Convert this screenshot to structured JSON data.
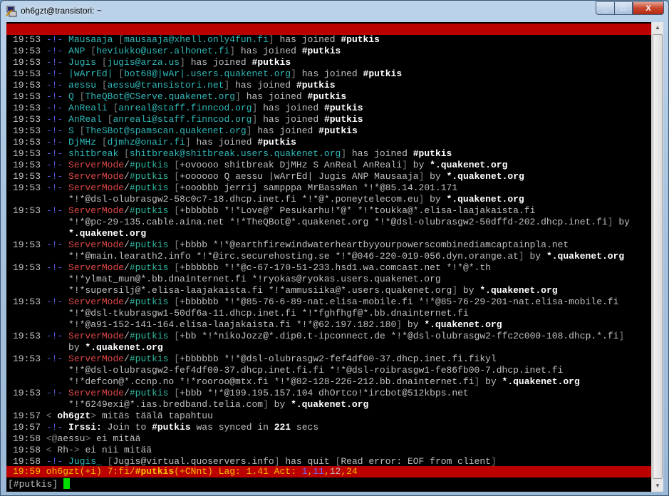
{
  "window": {
    "title": "oh6gzt@transistori: ~",
    "minimize": "_",
    "maximize": "□",
    "close": "X"
  },
  "colors": {
    "topbar": "#bb0000",
    "status_bg": "#bb0000",
    "cursor": "#00e000"
  },
  "lines": [
    [
      [
        "19:53 ",
        "d"
      ],
      [
        "-!- ",
        "b"
      ],
      [
        "Mausaaja ",
        "c"
      ],
      [
        "[",
        "k"
      ],
      [
        "mausaaja@xhell.only4fun.fi",
        "c"
      ],
      [
        "] ",
        "k"
      ],
      [
        "has joined ",
        "d"
      ],
      [
        "#putkis",
        "w"
      ]
    ],
    [
      [
        "19:53 ",
        "d"
      ],
      [
        "-!- ",
        "b"
      ],
      [
        "ANP ",
        "c"
      ],
      [
        "[",
        "k"
      ],
      [
        "heviukko@user.alhonet.fi",
        "c"
      ],
      [
        "] ",
        "k"
      ],
      [
        "has joined ",
        "d"
      ],
      [
        "#putkis",
        "w"
      ]
    ],
    [
      [
        "19:53 ",
        "d"
      ],
      [
        "-!- ",
        "b"
      ],
      [
        "Jugis ",
        "c"
      ],
      [
        "[",
        "k"
      ],
      [
        "jugis@arza.us",
        "c"
      ],
      [
        "] ",
        "k"
      ],
      [
        "has joined ",
        "d"
      ],
      [
        "#putkis",
        "w"
      ]
    ],
    [
      [
        "19:53 ",
        "d"
      ],
      [
        "-!- ",
        "b"
      ],
      [
        "|wArrEd| ",
        "c"
      ],
      [
        "[",
        "k"
      ],
      [
        "bot68@|wAr|.users.quakenet.org",
        "c"
      ],
      [
        "] ",
        "k"
      ],
      [
        "has joined ",
        "d"
      ],
      [
        "#putkis",
        "w"
      ]
    ],
    [
      [
        "19:53 ",
        "d"
      ],
      [
        "-!- ",
        "b"
      ],
      [
        "aessu ",
        "c"
      ],
      [
        "[",
        "k"
      ],
      [
        "aessu@transistori.net",
        "c"
      ],
      [
        "] ",
        "k"
      ],
      [
        "has joined ",
        "d"
      ],
      [
        "#putkis",
        "w"
      ]
    ],
    [
      [
        "19:53 ",
        "d"
      ],
      [
        "-!- ",
        "b"
      ],
      [
        "Q ",
        "c"
      ],
      [
        "[",
        "k"
      ],
      [
        "TheQBot@CServe.quakenet.org",
        "c"
      ],
      [
        "] ",
        "k"
      ],
      [
        "has joined ",
        "d"
      ],
      [
        "#putkis",
        "w"
      ]
    ],
    [
      [
        "19:53 ",
        "d"
      ],
      [
        "-!- ",
        "b"
      ],
      [
        "AnReali ",
        "c"
      ],
      [
        "[",
        "k"
      ],
      [
        "anreal@staff.finncod.org",
        "c"
      ],
      [
        "] ",
        "k"
      ],
      [
        "has joined ",
        "d"
      ],
      [
        "#putkis",
        "w"
      ]
    ],
    [
      [
        "19:53 ",
        "d"
      ],
      [
        "-!- ",
        "b"
      ],
      [
        "AnReal ",
        "c"
      ],
      [
        "[",
        "k"
      ],
      [
        "anreali@staff.finncod.org",
        "c"
      ],
      [
        "] ",
        "k"
      ],
      [
        "has joined ",
        "d"
      ],
      [
        "#putkis",
        "w"
      ]
    ],
    [
      [
        "19:53 ",
        "d"
      ],
      [
        "-!- ",
        "b"
      ],
      [
        "S ",
        "c"
      ],
      [
        "[",
        "k"
      ],
      [
        "TheSBot@spamscan.quakenet.org",
        "c"
      ],
      [
        "] ",
        "k"
      ],
      [
        "has joined ",
        "d"
      ],
      [
        "#putkis",
        "w"
      ]
    ],
    [
      [
        "19:53 ",
        "d"
      ],
      [
        "-!- ",
        "b"
      ],
      [
        "DjMHz ",
        "c"
      ],
      [
        "[",
        "k"
      ],
      [
        "djmhz@onair.fi",
        "c"
      ],
      [
        "] ",
        "k"
      ],
      [
        "has joined ",
        "d"
      ],
      [
        "#putkis",
        "w"
      ]
    ],
    [
      [
        "19:53 ",
        "d"
      ],
      [
        "-!- ",
        "b"
      ],
      [
        "shitbreak ",
        "c"
      ],
      [
        "[",
        "k"
      ],
      [
        "shitbreak@shitbreak.users.quakenet.org",
        "c"
      ],
      [
        "] ",
        "k"
      ],
      [
        "has joined ",
        "d"
      ],
      [
        "#putkis",
        "w"
      ]
    ],
    [
      [
        "19:53 ",
        "d"
      ],
      [
        "-!- ",
        "b"
      ],
      [
        "ServerMode",
        "r"
      ],
      [
        "/",
        "d"
      ],
      [
        "#putkis ",
        "t"
      ],
      [
        "[",
        "k"
      ],
      [
        "+ovoooo shitbreak DjMHz S AnReal AnReali",
        "d"
      ],
      [
        "] ",
        "k"
      ],
      [
        "by ",
        "d"
      ],
      [
        "*.quakenet.org",
        "w"
      ]
    ],
    [
      [
        "19:53 ",
        "d"
      ],
      [
        "-!- ",
        "b"
      ],
      [
        "ServerMode",
        "r"
      ],
      [
        "/",
        "d"
      ],
      [
        "#putkis ",
        "t"
      ],
      [
        "[",
        "k"
      ],
      [
        "+oooooo Q aessu |wArrEd| Jugis ANP Mausaaja",
        "d"
      ],
      [
        "] ",
        "k"
      ],
      [
        "by ",
        "d"
      ],
      [
        "*.quakenet.org",
        "w"
      ]
    ],
    [
      [
        "19:53 ",
        "d"
      ],
      [
        "-!- ",
        "b"
      ],
      [
        "ServerMode",
        "r"
      ],
      [
        "/",
        "d"
      ],
      [
        "#putkis ",
        "t"
      ],
      [
        "[",
        "k"
      ],
      [
        "+ooobbb jerrij sampppa MrBassMan *!*@85.14.201.171",
        "d"
      ]
    ],
    [
      [
        "          *!*@dsl-olubrasgw2-58c0c7-18.dhcp.inet.fi *!*@*.poneytelecom.eu",
        "d"
      ],
      [
        "] ",
        "k"
      ],
      [
        "by ",
        "d"
      ],
      [
        "*.quakenet.org",
        "w"
      ]
    ],
    [
      [
        "19:53 ",
        "d"
      ],
      [
        "-!- ",
        "b"
      ],
      [
        "ServerMode",
        "r"
      ],
      [
        "/",
        "d"
      ],
      [
        "#putkis ",
        "t"
      ],
      [
        "[",
        "k"
      ],
      [
        "+bbbbbb *!*Love@* Pesukarhu!*@* *!*toukka@*.elisa-laajakaista.fi",
        "d"
      ]
    ],
    [
      [
        "          *!*@pc-29-135.cable.aina.net *!*TheQBot@*.quakenet.org *!*@dsl-olubrasgw2-50dffd-202.dhcp.inet.fi",
        "d"
      ],
      [
        "] ",
        "k"
      ],
      [
        "by",
        "d"
      ]
    ],
    [
      [
        "          ",
        "d"
      ],
      [
        "*.quakenet.org",
        "w"
      ]
    ],
    [
      [
        "19:53 ",
        "d"
      ],
      [
        "-!- ",
        "b"
      ],
      [
        "ServerMode",
        "r"
      ],
      [
        "/",
        "d"
      ],
      [
        "#putkis ",
        "t"
      ],
      [
        "[",
        "k"
      ],
      [
        "+bbbb *!*@earthfirewindwaterheartbyyourpowerscombinediamcaptainpla.net",
        "d"
      ]
    ],
    [
      [
        "          *!*@main.learath2.info *!*@irc.securehosting.se *!*@046-220-019-056.dyn.orange.at",
        "d"
      ],
      [
        "] ",
        "k"
      ],
      [
        "by ",
        "d"
      ],
      [
        "*.quakenet.org",
        "w"
      ]
    ],
    [
      [
        "19:53 ",
        "d"
      ],
      [
        "-!- ",
        "b"
      ],
      [
        "ServerMode",
        "r"
      ],
      [
        "/",
        "d"
      ],
      [
        "#putkis ",
        "t"
      ],
      [
        "[",
        "k"
      ],
      [
        "+bbbbbb *!*@c-67-170-51-233.hsd1.wa.comcast.net *!*@*.th",
        "d"
      ]
    ],
    [
      [
        "          *!*ylmat_mun@*.bb.dnainternet.fi *!ryokas@ryokas.users.quakenet.org",
        "d"
      ]
    ],
    [
      [
        "          *!*supersilj@*.elisa-laajakaista.fi *!*ammusiika@*.users.quakenet.org",
        "d"
      ],
      [
        "] ",
        "k"
      ],
      [
        "by ",
        "d"
      ],
      [
        "*.quakenet.org",
        "w"
      ]
    ],
    [
      [
        "19:53 ",
        "d"
      ],
      [
        "-!- ",
        "b"
      ],
      [
        "ServerMode",
        "r"
      ],
      [
        "/",
        "d"
      ],
      [
        "#putkis ",
        "t"
      ],
      [
        "[",
        "k"
      ],
      [
        "+bbbbbb *!*@85-76-6-89-nat.elisa-mobile.fi *!*@85-76-29-201-nat.elisa-mobile.fi",
        "d"
      ]
    ],
    [
      [
        "          *!*@dsl-tkubrasgw1-50df6a-11.dhcp.inet.fi *!*fghfhgf@*.bb.dnainternet.fi",
        "d"
      ]
    ],
    [
      [
        "          *!*@a91-152-141-164.elisa-laajakaista.fi *!*@62.197.182.180",
        "d"
      ],
      [
        "] ",
        "k"
      ],
      [
        "by ",
        "d"
      ],
      [
        "*.quakenet.org",
        "w"
      ]
    ],
    [
      [
        "19:53 ",
        "d"
      ],
      [
        "-!- ",
        "b"
      ],
      [
        "ServerMode",
        "r"
      ],
      [
        "/",
        "d"
      ],
      [
        "#putkis ",
        "t"
      ],
      [
        "[",
        "k"
      ],
      [
        "+bb *!*nikoJozz@*.dip0.t-ipconnect.de *!*@dsl-olubrasgw2-ffc2c000-108.dhcp.*.fi",
        "d"
      ],
      [
        "]",
        "k"
      ]
    ],
    [
      [
        "          by ",
        "d"
      ],
      [
        "*.quakenet.org",
        "w"
      ]
    ],
    [
      [
        "19:53 ",
        "d"
      ],
      [
        "-!- ",
        "b"
      ],
      [
        "ServerMode",
        "r"
      ],
      [
        "/",
        "d"
      ],
      [
        "#putkis ",
        "t"
      ],
      [
        "[",
        "k"
      ],
      [
        "+bbbbbb *!*@dsl-olubrasgw2-fef4df00-37.dhcp.inet.fi.fikyl",
        "d"
      ]
    ],
    [
      [
        "          *!*@dsl-olubrasgw2-fef4df00-37.dhcp.inet.fi.fi *!*@dsl-roibrasgw1-fe86fb00-7.dhcp.inet.fi",
        "d"
      ]
    ],
    [
      [
        "          *!*defcon@*.ccnp.no *!*rooroo@mtx.fi *!*@82-128-226-212.bb.dnainternet.fi",
        "d"
      ],
      [
        "] ",
        "k"
      ],
      [
        "by ",
        "d"
      ],
      [
        "*.quakenet.org",
        "w"
      ]
    ],
    [
      [
        "19:53 ",
        "d"
      ],
      [
        "-!- ",
        "b"
      ],
      [
        "ServerMode",
        "r"
      ],
      [
        "/",
        "d"
      ],
      [
        "#putkis ",
        "t"
      ],
      [
        "[",
        "k"
      ],
      [
        "+bbb *!*@199.195.157.104 dhOrtco!*ircbot@512kbps.net",
        "d"
      ]
    ],
    [
      [
        "          *!*6249exi@*.ias.bredband.telia.com",
        "d"
      ],
      [
        "] ",
        "k"
      ],
      [
        "by ",
        "d"
      ],
      [
        "*.quakenet.org",
        "w"
      ]
    ],
    [
      [
        "19:57 ",
        "d"
      ],
      [
        "< ",
        "k"
      ],
      [
        "oh6gzt",
        "w"
      ],
      [
        "> ",
        "k"
      ],
      [
        "mitäs täälä tapahtuu",
        "d"
      ]
    ],
    [
      [
        "19:57 ",
        "d"
      ],
      [
        "-!- ",
        "b"
      ],
      [
        "Irssi: ",
        "w"
      ],
      [
        "Join to ",
        "d"
      ],
      [
        "#putkis ",
        "w"
      ],
      [
        "was synced in ",
        "d"
      ],
      [
        "221",
        "w"
      ],
      [
        " secs",
        "d"
      ]
    ],
    [
      [
        "19:58 ",
        "d"
      ],
      [
        "<@",
        "k"
      ],
      [
        "aessu",
        "d"
      ],
      [
        "> ",
        "k"
      ],
      [
        "ei mitää",
        "d"
      ]
    ],
    [
      [
        "19:58 ",
        "d"
      ],
      [
        "< ",
        "k"
      ],
      [
        "Rh-",
        "d"
      ],
      [
        "> ",
        "k"
      ],
      [
        "ei nii mitää",
        "d"
      ]
    ],
    [
      [
        "19:58 ",
        "d"
      ],
      [
        "-!- ",
        "b"
      ],
      [
        "Jugis_ ",
        "c"
      ],
      [
        "[",
        "k"
      ],
      [
        "Jugis@virtual.quoservers.info",
        "d"
      ],
      [
        "] ",
        "k"
      ],
      [
        "has quit ",
        "d"
      ],
      [
        "[",
        "k"
      ],
      [
        "Read error: EOF from client",
        "d"
      ],
      [
        "]",
        "k"
      ]
    ]
  ],
  "status": [
    [
      "19:59 oh6gzt(+i) 7:fi/",
      "y"
    ],
    [
      "#putkis",
      "yb"
    ],
    [
      "(+CNnt) Lag: 1.41 Act: ",
      "y"
    ],
    [
      "1",
      "bl"
    ],
    [
      ",",
      "y"
    ],
    [
      "11",
      "bl"
    ],
    [
      ",",
      "y"
    ],
    [
      "12",
      "d"
    ],
    [
      ",24",
      "y"
    ]
  ],
  "prompt": "[#putkis]"
}
